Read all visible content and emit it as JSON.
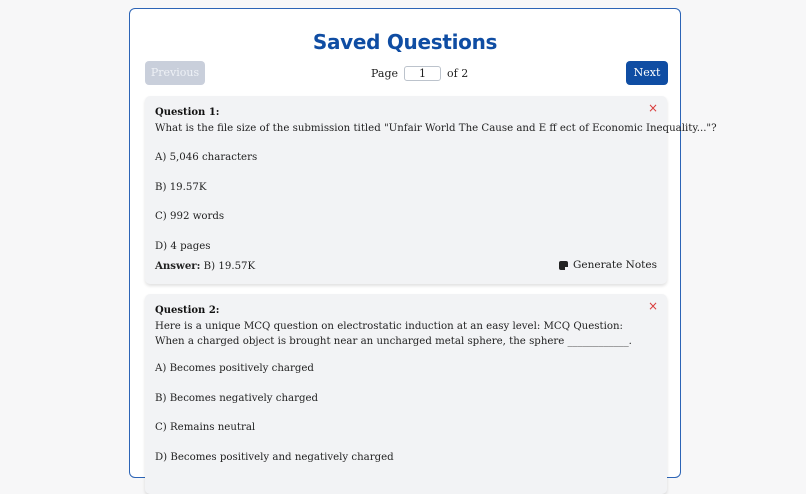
{
  "header": {
    "title": "Saved Questions"
  },
  "pagination": {
    "previous_label": "Previous",
    "next_label": "Next",
    "page_prefix": "Page",
    "current_page": "1",
    "total_text": "of 2"
  },
  "questions": [
    {
      "label": "Question 1:",
      "text": "What is the file size of the submission titled \"Unfair World The Cause and E ff ect of Economic Inequality...\"?",
      "options": [
        "A) 5,046 characters",
        "B) 19.57K",
        "C) 992 words",
        "D) 4 pages"
      ],
      "answer_label": "Answer:",
      "answer_value": " B) 19.57K",
      "close_glyph": "×",
      "generate_notes_label": "Generate Notes"
    },
    {
      "label": "Question 2:",
      "text": "Here is a unique MCQ question on electrostatic induction at an easy level: MCQ Question: When a charged object is brought near an uncharged metal sphere, the sphere ____________.",
      "options": [
        "A) Becomes positively charged",
        "B) Becomes negatively charged",
        "C) Remains neutral",
        "D) Becomes positively and negatively charged"
      ],
      "close_glyph": "×"
    }
  ],
  "colors": {
    "accent": "#0f4da3",
    "disabled_button": "#c9cfdb",
    "card_background": "#f2f3f5",
    "close_red": "#d93b3b"
  },
  "icons": {
    "close": "close-icon",
    "notes": "note-icon"
  }
}
